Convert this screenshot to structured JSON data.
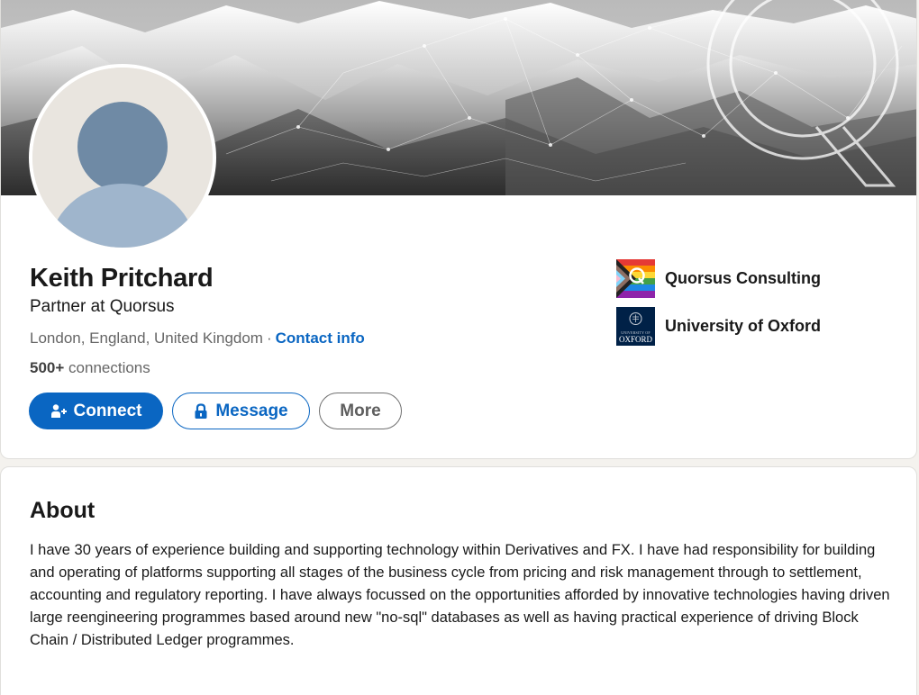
{
  "profile": {
    "name": "Keith Pritchard",
    "headline": "Partner at Quorsus",
    "location": "London, England, United Kingdom",
    "separator": "·",
    "contact_info_label": "Contact info",
    "connections_count": "500+",
    "connections_label": "connections"
  },
  "actions": {
    "connect_label": "Connect",
    "message_label": "Message",
    "more_label": "More"
  },
  "organizations": [
    {
      "name": "Quorsus Consulting",
      "logo": "quorsus-logo"
    },
    {
      "name": "University of Oxford",
      "logo": "oxford-logo",
      "logo_text_top": "UNIVERSITY OF",
      "logo_text_bottom": "OXFORD"
    }
  ],
  "about": {
    "title": "About",
    "text": "I have 30 years of experience building and supporting technology within Derivatives and FX. I have had responsibility for building and operating of platforms supporting all stages of the business cycle from pricing and risk management through to settlement, accounting and regulatory reporting. I have always focussed on the opportunities afforded by innovative technologies having driven large reengineering programmes based around new \"no-sql\" databases as well as having practical experience of driving Block Chain / Distributed Ledger programmes."
  },
  "colors": {
    "brand_blue": "#0a66c2",
    "avatar_bg": "#e9e5df",
    "avatar_figure": "#9fb5cc",
    "oxford_blue": "#002147"
  }
}
